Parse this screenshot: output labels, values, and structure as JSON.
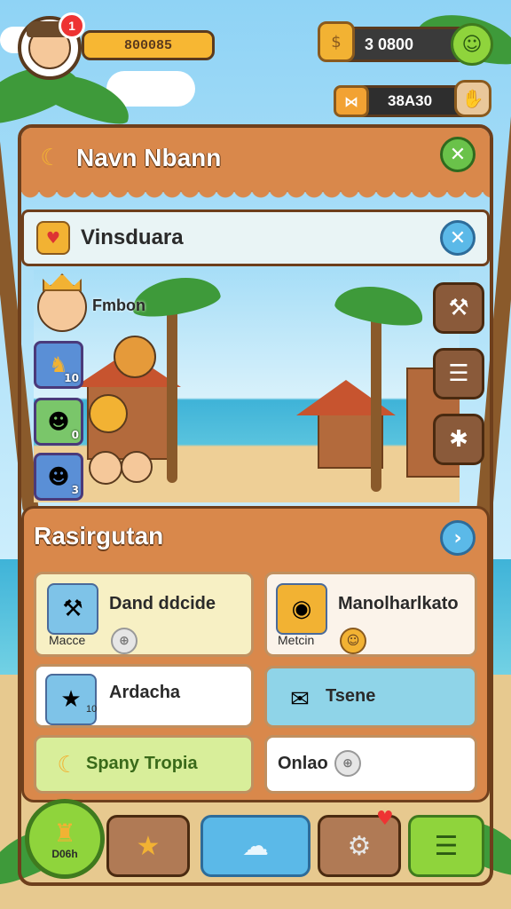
{
  "header": {
    "notification_count": "1",
    "xp_value": "800085",
    "gold_value": "3  0800",
    "ticket_value": "38A30"
  },
  "dialog": {
    "title": "Navn Nbann",
    "subtitle": "Vinsduara"
  },
  "scene": {
    "leader_label": "Fmbon",
    "slots": [
      {
        "count": "10"
      },
      {
        "count": "0"
      },
      {
        "count": "3"
      }
    ]
  },
  "resources": {
    "title": "Rasirgutan",
    "cards": [
      {
        "title": "Dand ddcide",
        "subtitle": "Macce",
        "icon": "hammer-icon"
      },
      {
        "title": "Manolharlkato",
        "subtitle": "Metcin",
        "icon": "drum-icon"
      },
      {
        "title": "Ardacha",
        "subtitle": "10",
        "icon": "star-icon"
      },
      {
        "title": "Tsene",
        "subtitle": "",
        "icon": "gift-icon"
      },
      {
        "title": "Spany Tropia",
        "subtitle": "",
        "icon": "banana-icon"
      },
      {
        "title": "Onlao",
        "subtitle": "",
        "icon": "info-icon"
      }
    ]
  },
  "nav": {
    "home_label": "D06h"
  },
  "colors": {
    "panel": "#d9884b",
    "border": "#6e3f1c",
    "accent_green": "#6ac24a",
    "accent_blue": "#5bb9e8"
  }
}
